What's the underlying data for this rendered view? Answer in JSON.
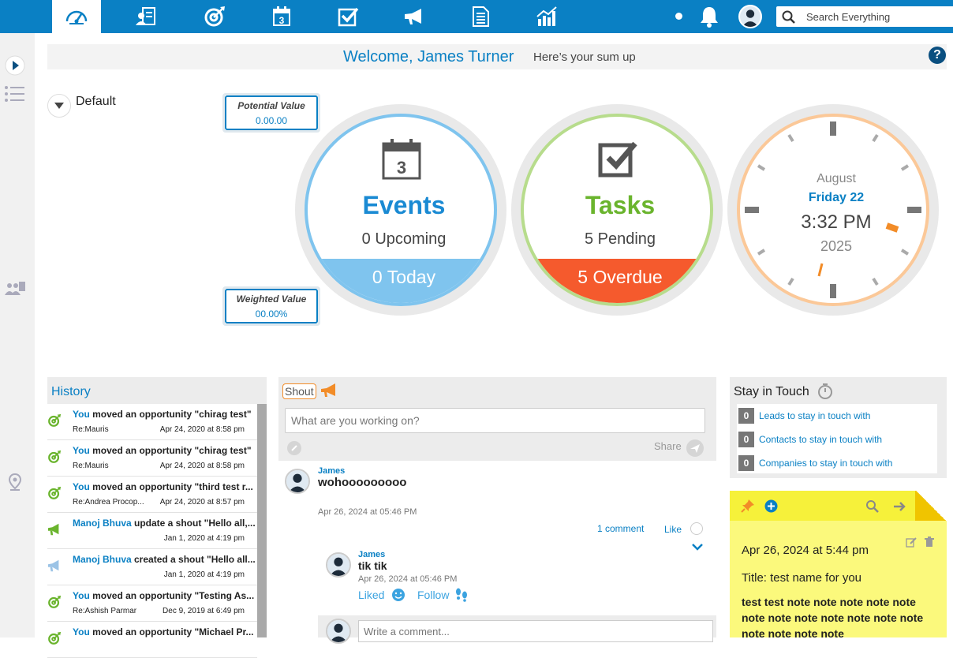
{
  "topnav": {
    "items": [
      {
        "name": "dashboard-icon",
        "active": true
      },
      {
        "name": "contacts-icon"
      },
      {
        "name": "opportunities-icon"
      },
      {
        "name": "calendar-icon",
        "label": "3"
      },
      {
        "name": "tasks-icon"
      },
      {
        "name": "campaigns-icon"
      },
      {
        "name": "documents-icon"
      },
      {
        "name": "reports-icon"
      }
    ],
    "search_placeholder": "Search Everything",
    "colors": {
      "bar": "#0a80c4"
    }
  },
  "welcome": {
    "greeting": "Welcome, James Turner",
    "subtitle": "Here’s your sum up",
    "help": "?"
  },
  "filter": {
    "selected": "Default"
  },
  "potential": {
    "label": "Potential Value",
    "value": "0.00.00"
  },
  "weighted": {
    "label": "Weighted Value",
    "value": "00.00%"
  },
  "events": {
    "title": "Events",
    "upcoming": "0 Upcoming",
    "today": "0 Today",
    "icon_number": "3",
    "color": "#1a8ad3",
    "ring": "#7fc4ee"
  },
  "tasks": {
    "title": "Tasks",
    "pending": "5 Pending",
    "overdue": "5 Overdue",
    "color": "#6ab42d",
    "ring": "#b7dc8c",
    "overdue_color": "#f55a2d"
  },
  "clock": {
    "month": "August",
    "day": "Friday 22",
    "time": "3:32 PM",
    "year": "2025"
  },
  "history": {
    "title": "History",
    "items": [
      {
        "icon": "opportunity-icon",
        "who": "You",
        "text": " moved an opportunity \"chirag test\"",
        "re": "Re:Mauris",
        "date": "Apr 24, 2020 at 8:58 pm"
      },
      {
        "icon": "opportunity-icon",
        "who": "You",
        "text": " moved an opportunity \"chirag test\"",
        "re": "Re:Mauris",
        "date": "Apr 24, 2020 at 8:58 pm"
      },
      {
        "icon": "opportunity-icon",
        "who": "You",
        "text": " moved an opportunity \"third test r...",
        "re": "Re:Andrea Procop...",
        "date": "Apr 24, 2020 at 8:57 pm"
      },
      {
        "icon": "shout-icon",
        "who": "Manoj Bhuva",
        "text": " update a shout \"Hello all,...",
        "re": "",
        "date": "Jan 1, 2020 at 4:19 pm"
      },
      {
        "icon": "shout-icon",
        "who": "Manoj Bhuva",
        "text": " created a shout \"Hello all...",
        "re": "",
        "date": "Jan 1, 2020 at 4:19 pm"
      },
      {
        "icon": "opportunity-icon",
        "who": "You",
        "text": " moved an opportunity \"Testing As...",
        "re": "Re:Ashish Parmar",
        "date": "Dec 9, 2019 at 6:49 pm"
      },
      {
        "icon": "opportunity-icon",
        "who": "You",
        "text": " moved an opportunity \"Michael Pr...",
        "re": "",
        "date": ""
      }
    ]
  },
  "shout": {
    "tab": "Shout",
    "placeholder": "What are you working on?",
    "share": "Share",
    "post": {
      "author": "James",
      "text": "wohooooooooo",
      "date": "Apr 26, 2024 at 05:46 PM",
      "comments": "1 comment",
      "like": "Like"
    },
    "reply": {
      "author": "James",
      "text": "tik tik",
      "date": "Apr 26, 2024 at 05:46 PM",
      "liked": "Liked",
      "follow": "Follow"
    },
    "comment_placeholder": "Write a comment..."
  },
  "stay": {
    "title": "Stay in Touch",
    "items": [
      {
        "count": "0",
        "label": "Leads to stay in touch with"
      },
      {
        "count": "0",
        "label": "Contacts to stay in touch with"
      },
      {
        "count": "0",
        "label": "Companies to stay in touch with"
      }
    ]
  },
  "note": {
    "date": "Apr 26, 2024 at 5:44 pm",
    "title": "Title: test name for you",
    "body": "test test note note note note note note note note note note note note note note note note"
  }
}
